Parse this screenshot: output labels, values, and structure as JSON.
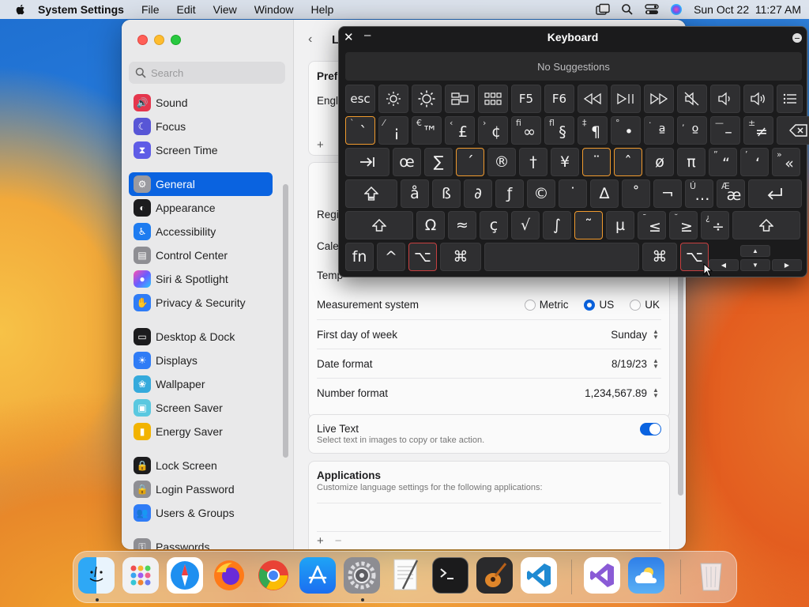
{
  "menubar": {
    "app_name": "System Settings",
    "menus": [
      "File",
      "Edit",
      "View",
      "Window",
      "Help"
    ],
    "datetime": "Sun Oct 22  11:27 AM"
  },
  "settings": {
    "search_placeholder": "Search",
    "sidebar": [
      {
        "label": "Sound",
        "icon": "sound-icon",
        "color": "#e5364d"
      },
      {
        "label": "Focus",
        "icon": "moon-icon",
        "color": "#5856d6"
      },
      {
        "label": "Screen Time",
        "icon": "hourglass-icon",
        "color": "#5e5ce6"
      },
      {
        "label": "General",
        "icon": "gear-icon",
        "color": "#8e8e93",
        "active": true
      },
      {
        "label": "Appearance",
        "icon": "appearance-icon",
        "color": "#1c1c1e"
      },
      {
        "label": "Accessibility",
        "icon": "accessibility-icon",
        "color": "#1e7cf0"
      },
      {
        "label": "Control Center",
        "icon": "control-center-icon",
        "color": "#8e8e93"
      },
      {
        "label": "Siri & Spotlight",
        "icon": "siri-icon",
        "color": "#b03ad0"
      },
      {
        "label": "Privacy & Security",
        "icon": "hand-icon",
        "color": "#2f7cf6"
      },
      {
        "label": "Desktop & Dock",
        "icon": "dock-icon",
        "color": "#1c1c1e"
      },
      {
        "label": "Displays",
        "icon": "displays-icon",
        "color": "#2f7cf6"
      },
      {
        "label": "Wallpaper",
        "icon": "wallpaper-icon",
        "color": "#35aadc"
      },
      {
        "label": "Screen Saver",
        "icon": "screen-saver-icon",
        "color": "#5ac8e0"
      },
      {
        "label": "Energy Saver",
        "icon": "battery-icon",
        "color": "#f2b300"
      },
      {
        "label": "Lock Screen",
        "icon": "lock-icon",
        "color": "#1c1c1e"
      },
      {
        "label": "Login Password",
        "icon": "lock-icon",
        "color": "#8e8e93"
      },
      {
        "label": "Users & Groups",
        "icon": "users-icon",
        "color": "#2f7cf6"
      },
      {
        "label": "Passwords",
        "icon": "key-icon",
        "color": "#8e8e93"
      }
    ],
    "content": {
      "title_partial": "L",
      "preferred_heading_partial": "Pref",
      "language_partial": "Engl",
      "region_partial": "Regi",
      "calendar_partial": "Cale",
      "temp_partial": "Temp",
      "measurement": {
        "label": "Measurement system",
        "options": [
          "Metric",
          "US",
          "UK"
        ],
        "selected": "US"
      },
      "first_day": {
        "label": "First day of week",
        "value": "Sunday"
      },
      "date_format": {
        "label": "Date format",
        "value": "8/19/23"
      },
      "number_format": {
        "label": "Number format",
        "value": "1,234,567.89"
      },
      "live_text": {
        "label": "Live Text",
        "desc": "Select text in images to copy or take action.",
        "on": true
      },
      "applications": {
        "label": "Applications",
        "desc": "Customize language settings for the following applications:"
      },
      "add": "+",
      "remove": "−"
    }
  },
  "keyboard": {
    "title": "Keyboard",
    "suggestions": "No Suggestions",
    "row_fn": [
      "esc",
      "brightness-down-icon",
      "brightness-up-icon",
      "mission-control-icon",
      "launchpad-icon",
      "F5",
      "F6",
      "rewind-icon",
      "play-pause-icon",
      "fast-forward-icon",
      "mute-icon",
      "volume-down-icon",
      "volume-up-icon",
      "list-icon"
    ],
    "row1": [
      {
        "cap": "`",
        "main": "`",
        "hl": true
      },
      {
        "cap": "⁄",
        "main": "¡"
      },
      {
        "cap": "€",
        "main": "™"
      },
      {
        "cap": "‹",
        "main": "£"
      },
      {
        "cap": "›",
        "main": "¢"
      },
      {
        "cap": "ﬁ",
        "main": "∞"
      },
      {
        "cap": "ﬂ",
        "main": "§"
      },
      {
        "cap": "‡",
        "main": "¶"
      },
      {
        "cap": "°",
        "main": "•"
      },
      {
        "cap": "·",
        "main": "ª"
      },
      {
        "cap": "‚",
        "main": "º"
      },
      {
        "cap": "—",
        "main": "–"
      },
      {
        "cap": "±",
        "main": "≠"
      }
    ],
    "row2": [
      {
        "main": "œ"
      },
      {
        "main": "∑"
      },
      {
        "main": "´",
        "hl": true
      },
      {
        "main": "®"
      },
      {
        "main": "†"
      },
      {
        "main": "¥"
      },
      {
        "main": "¨",
        "hl": true
      },
      {
        "main": "ˆ",
        "hl": true
      },
      {
        "main": "ø"
      },
      {
        "main": "π"
      },
      {
        "cap": "”",
        "main": "“"
      },
      {
        "cap": "’",
        "main": "‘"
      },
      {
        "cap": "»",
        "main": "«"
      }
    ],
    "row3": [
      {
        "main": "å"
      },
      {
        "main": "ß"
      },
      {
        "main": "∂"
      },
      {
        "main": "ƒ"
      },
      {
        "main": "©"
      },
      {
        "main": "˙"
      },
      {
        "main": "∆"
      },
      {
        "main": "˚"
      },
      {
        "main": "¬"
      },
      {
        "cap": "Ú",
        "main": "…"
      },
      {
        "cap": "Æ",
        "main": "æ"
      }
    ],
    "row4": [
      {
        "main": "Ω"
      },
      {
        "main": "≈"
      },
      {
        "main": "ç"
      },
      {
        "main": "√"
      },
      {
        "main": "∫"
      },
      {
        "main": "˜",
        "hl": true
      },
      {
        "main": "µ"
      },
      {
        "cap": "¯",
        "main": "≤"
      },
      {
        "cap": "˘",
        "main": "≥"
      },
      {
        "cap": "¿",
        "main": "÷"
      }
    ],
    "row5": {
      "fn": "fn",
      "ctrl": "^",
      "opt": "⌥",
      "cmd": "⌘"
    }
  },
  "dock": [
    "finder-icon",
    "launchpad-icon",
    "safari-icon",
    "firefox-icon",
    "chrome-icon",
    "app-store-icon",
    "system-settings-icon",
    "textedit-icon",
    "terminal-icon",
    "garageband-icon",
    "vscode-icon",
    "visual-studio-icon",
    "weather-icon",
    "trash-icon"
  ]
}
